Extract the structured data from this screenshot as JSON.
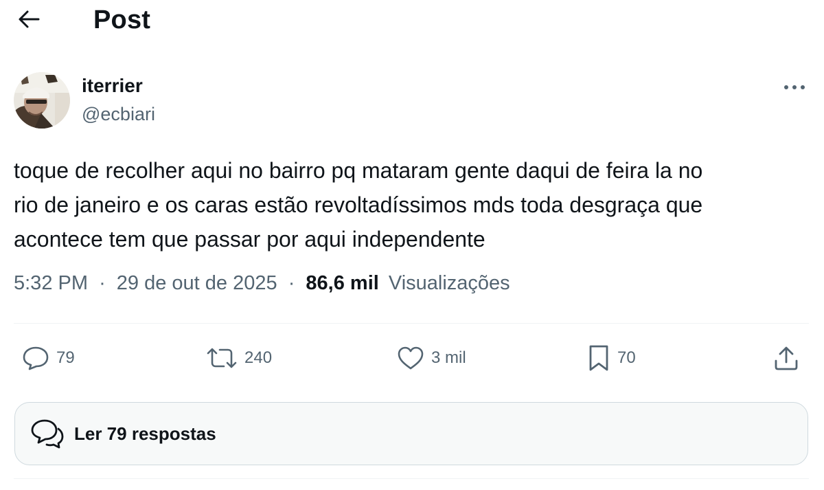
{
  "header": {
    "title": "Post"
  },
  "author": {
    "name": "iterrier",
    "handle": "@ecbiari"
  },
  "post": {
    "lines": [
      "toque de recolher aqui no bairro pq mataram gente daqui de feira la no",
      "rio de janeiro e os caras estão revoltadíssimos mds toda desgraça que",
      "acontece tem que passar por aqui independente"
    ]
  },
  "meta": {
    "time": "5:32 PM",
    "sep1": "·",
    "date": "29 de out de 2025",
    "sep2": "·",
    "views_count": "86,6 mil",
    "views_label": "Visualizações"
  },
  "actions": {
    "reply_count": "79",
    "repost_count": "240",
    "like_count": "3 mil",
    "bookmark_count": "70"
  },
  "replies_button": {
    "label": "Ler 79 respostas"
  },
  "icons": {
    "back": "arrow-left-icon",
    "more": "more-horizontal-icon",
    "reply": "speech-bubble-icon",
    "repost": "repost-arrows-icon",
    "like": "heart-icon",
    "bookmark": "bookmark-icon",
    "share": "share-upload-icon",
    "replies": "conversation-bubbles-icon"
  },
  "colors": {
    "text_primary": "#0f1419",
    "text_secondary": "#536471",
    "divider": "#eff3f4",
    "button_bg": "#f7f9f9",
    "button_border": "#cfd9de"
  }
}
